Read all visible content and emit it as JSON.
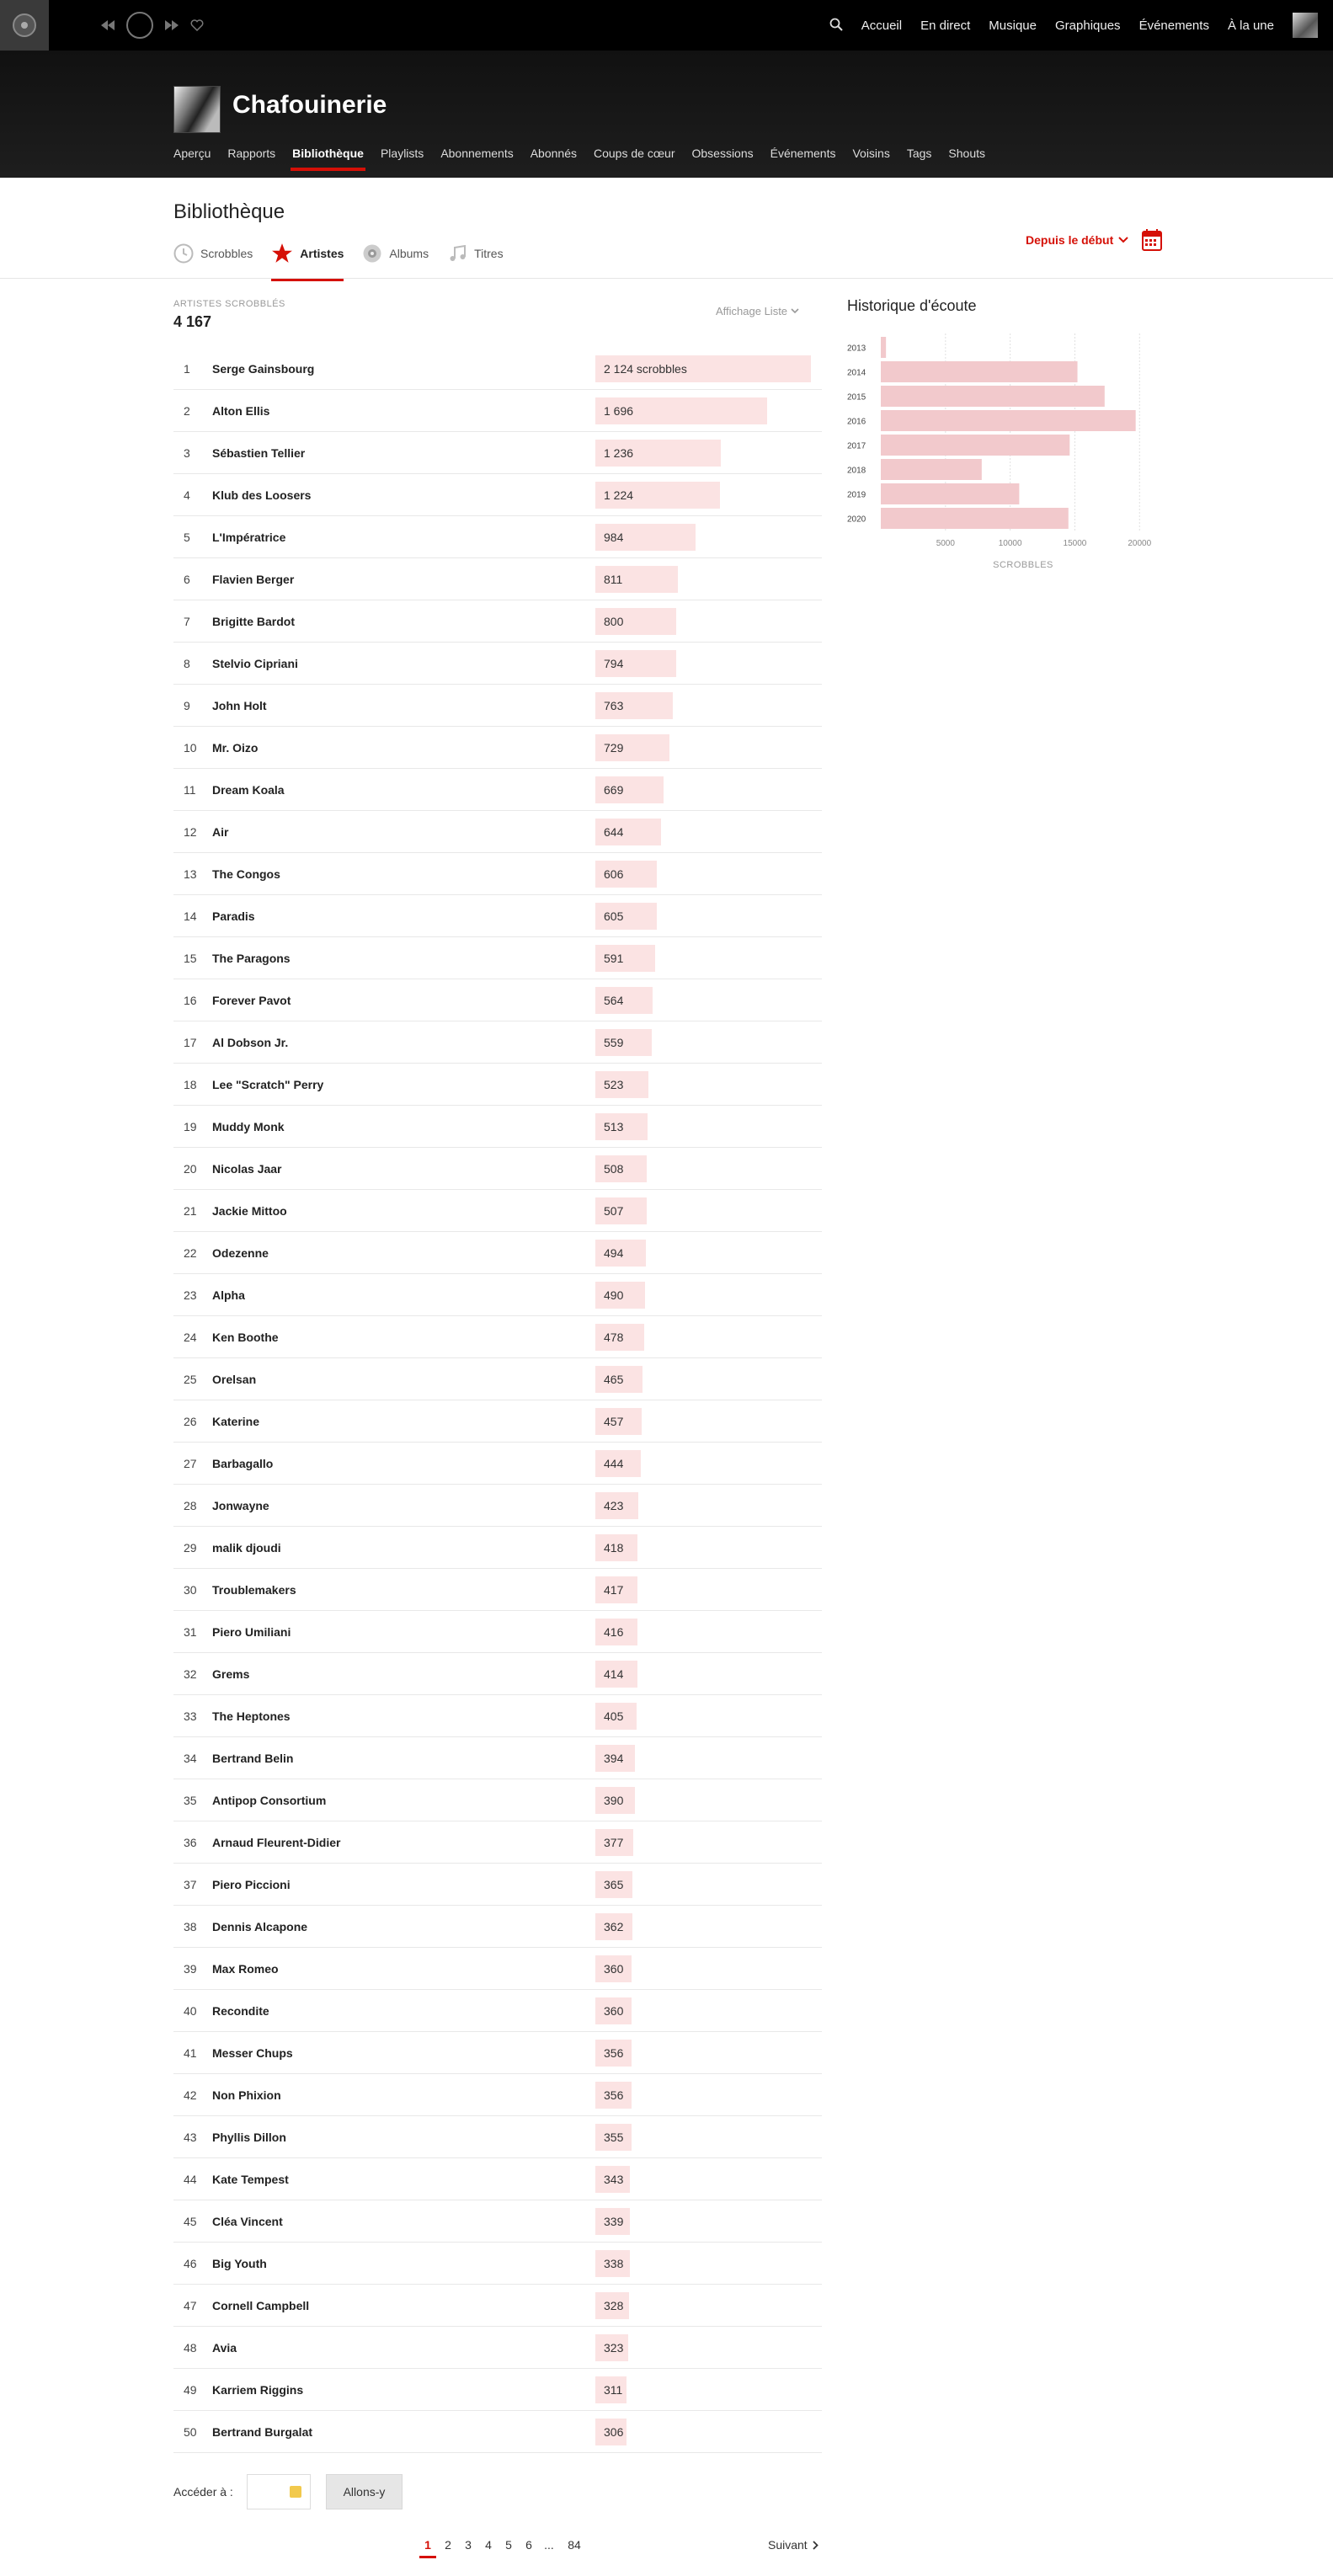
{
  "topbar": {
    "nav": [
      "Accueil",
      "En direct",
      "Musique",
      "Graphiques",
      "Événements",
      "À la une"
    ]
  },
  "profile": {
    "name": "Chafouinerie",
    "tabs": [
      "Aperçu",
      "Rapports",
      "Bibliothèque",
      "Playlists",
      "Abonnements",
      "Abonnés",
      "Coups de cœur",
      "Obsessions",
      "Événements",
      "Voisins",
      "Tags",
      "Shouts"
    ],
    "active_tab": "Bibliothèque"
  },
  "library": {
    "title": "Bibliothèque",
    "tabs": [
      "Scrobbles",
      "Artistes",
      "Albums",
      "Titres"
    ],
    "active_tab": "Artistes",
    "period": "Depuis le début",
    "count_label": "Artistes scrobblés",
    "count_value": "4 167",
    "view_mode": "Affichage Liste",
    "max_scrobbles": 2124
  },
  "artists": [
    {
      "rank": "1",
      "name": "Serge Gainsbourg",
      "count": "2 124 scrobbles",
      "value": 2124
    },
    {
      "rank": "2",
      "name": "Alton Ellis",
      "count": "1 696",
      "value": 1696
    },
    {
      "rank": "3",
      "name": "Sébastien Tellier",
      "count": "1 236",
      "value": 1236
    },
    {
      "rank": "4",
      "name": "Klub des Loosers",
      "count": "1 224",
      "value": 1224
    },
    {
      "rank": "5",
      "name": "L'Impératrice",
      "count": "984",
      "value": 984
    },
    {
      "rank": "6",
      "name": "Flavien Berger",
      "count": "811",
      "value": 811
    },
    {
      "rank": "7",
      "name": "Brigitte Bardot",
      "count": "800",
      "value": 800
    },
    {
      "rank": "8",
      "name": "Stelvio Cipriani",
      "count": "794",
      "value": 794
    },
    {
      "rank": "9",
      "name": "John Holt",
      "count": "763",
      "value": 763
    },
    {
      "rank": "10",
      "name": "Mr. Oizo",
      "count": "729",
      "value": 729
    },
    {
      "rank": "11",
      "name": "Dream Koala",
      "count": "669",
      "value": 669
    },
    {
      "rank": "12",
      "name": "Air",
      "count": "644",
      "value": 644
    },
    {
      "rank": "13",
      "name": "The Congos",
      "count": "606",
      "value": 606
    },
    {
      "rank": "14",
      "name": "Paradis",
      "count": "605",
      "value": 605
    },
    {
      "rank": "15",
      "name": "The Paragons",
      "count": "591",
      "value": 591
    },
    {
      "rank": "16",
      "name": "Forever Pavot",
      "count": "564",
      "value": 564
    },
    {
      "rank": "17",
      "name": "Al Dobson Jr.",
      "count": "559",
      "value": 559
    },
    {
      "rank": "18",
      "name": "Lee \"Scratch\" Perry",
      "count": "523",
      "value": 523
    },
    {
      "rank": "19",
      "name": "Muddy Monk",
      "count": "513",
      "value": 513
    },
    {
      "rank": "20",
      "name": "Nicolas Jaar",
      "count": "508",
      "value": 508
    },
    {
      "rank": "21",
      "name": "Jackie Mittoo",
      "count": "507",
      "value": 507
    },
    {
      "rank": "22",
      "name": "Odezenne",
      "count": "494",
      "value": 494
    },
    {
      "rank": "23",
      "name": "Alpha",
      "count": "490",
      "value": 490
    },
    {
      "rank": "24",
      "name": "Ken Boothe",
      "count": "478",
      "value": 478
    },
    {
      "rank": "25",
      "name": "Orelsan",
      "count": "465",
      "value": 465
    },
    {
      "rank": "26",
      "name": "Katerine",
      "count": "457",
      "value": 457
    },
    {
      "rank": "27",
      "name": "Barbagallo",
      "count": "444",
      "value": 444
    },
    {
      "rank": "28",
      "name": "Jonwayne",
      "count": "423",
      "value": 423
    },
    {
      "rank": "29",
      "name": "malik djoudi",
      "count": "418",
      "value": 418
    },
    {
      "rank": "30",
      "name": "Troublemakers",
      "count": "417",
      "value": 417
    },
    {
      "rank": "31",
      "name": "Piero Umiliani",
      "count": "416",
      "value": 416
    },
    {
      "rank": "32",
      "name": "Grems",
      "count": "414",
      "value": 414
    },
    {
      "rank": "33",
      "name": "The Heptones",
      "count": "405",
      "value": 405
    },
    {
      "rank": "34",
      "name": "Bertrand Belin",
      "count": "394",
      "value": 394
    },
    {
      "rank": "35",
      "name": "Antipop Consortium",
      "count": "390",
      "value": 390
    },
    {
      "rank": "36",
      "name": "Arnaud Fleurent-Didier",
      "count": "377",
      "value": 377
    },
    {
      "rank": "37",
      "name": "Piero Piccioni",
      "count": "365",
      "value": 365
    },
    {
      "rank": "38",
      "name": "Dennis Alcapone",
      "count": "362",
      "value": 362
    },
    {
      "rank": "39",
      "name": "Max Romeo",
      "count": "360",
      "value": 360
    },
    {
      "rank": "40",
      "name": "Recondite",
      "count": "360",
      "value": 360
    },
    {
      "rank": "41",
      "name": "Messer Chups",
      "count": "356",
      "value": 356
    },
    {
      "rank": "42",
      "name": "Non Phixion",
      "count": "356",
      "value": 356
    },
    {
      "rank": "43",
      "name": "Phyllis Dillon",
      "count": "355",
      "value": 355
    },
    {
      "rank": "44",
      "name": "Kate Tempest",
      "count": "343",
      "value": 343
    },
    {
      "rank": "45",
      "name": "Cléa Vincent",
      "count": "339",
      "value": 339
    },
    {
      "rank": "46",
      "name": "Big Youth",
      "count": "338",
      "value": 338
    },
    {
      "rank": "47",
      "name": "Cornell Campbell",
      "count": "328",
      "value": 328
    },
    {
      "rank": "48",
      "name": "Avia",
      "count": "323",
      "value": 323
    },
    {
      "rank": "49",
      "name": "Karriem Riggins",
      "count": "311",
      "value": 311
    },
    {
      "rank": "50",
      "name": "Bertrand Burgalat",
      "count": "306",
      "value": 306
    }
  ],
  "pagination": {
    "goto_label": "Accéder à :",
    "goto_button": "Allons-y",
    "pages": [
      "1",
      "2",
      "3",
      "4",
      "5",
      "6",
      "...",
      "84"
    ],
    "current": "1",
    "next_label": "Suivant"
  },
  "chart_data": {
    "type": "bar",
    "orientation": "horizontal",
    "title": "Historique d'écoute",
    "categories": [
      "2013",
      "2014",
      "2015",
      "2016",
      "2017",
      "2018",
      "2019",
      "2020"
    ],
    "values": [
      400,
      15200,
      17300,
      19700,
      14600,
      7800,
      10700,
      14500
    ],
    "xlabel": "SCROBBLES",
    "xticks": [
      "5000",
      "10000",
      "15000",
      "20000"
    ],
    "xlim": [
      0,
      22000
    ],
    "grid": true,
    "colors": {
      "bar": "#f2c9cc",
      "grid": "#e0e0e0"
    }
  },
  "colors": {
    "accent": "#d51007",
    "list_bar": "#fbe3e3"
  }
}
